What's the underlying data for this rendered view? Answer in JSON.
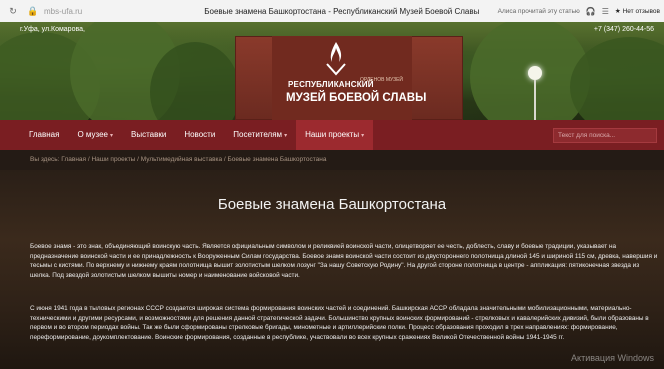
{
  "browser": {
    "url": "mbs-ufa.ru",
    "title": "Боевые знамена Башкортостана - Республиканский Музей Боевой Славы",
    "reader_label": "Алиса прочитай эту статью",
    "favorites_label": "Нет отзывов"
  },
  "header": {
    "address": "г.Уфа, ул.Комарова,",
    "phone": "+7 (347) 260-44-56",
    "brand_line1": "РЕСПУБЛИКАНСКИЙ",
    "brand_line1_small": "ОРДЕНОВ МУЗЕЙ",
    "brand_line2": "МУЗЕЙ БОЕВОЙ СЛАВЫ"
  },
  "menu": {
    "items": [
      {
        "label": "Главная"
      },
      {
        "label": "О музее"
      },
      {
        "label": "Выставки"
      },
      {
        "label": "Новости"
      },
      {
        "label": "Посетителям"
      },
      {
        "label": "Наши проекты"
      }
    ],
    "search_placeholder": "Текст для поиска..."
  },
  "breadcrumb": {
    "text": "Вы здесь: Главная / Наши проекты / Мультимедийная выставка / Боевые знамена Башкортостана"
  },
  "article": {
    "title": "Боевые знамена Башкортостана",
    "paragraph1": "Боевое знамя - это знак, объединяющий воинскую часть. Является официальным символом и реликвией воинской части, олицетворяет ее честь, доблесть, славу и боевые традиции, указывает на предназначение воинской части и ее принадлежность к Вооруженным Силам государства. Боевое знамя воинской части состоит из двустороннего полотнища длиной 145 и шириной 115 см, древка, навершия и тесьмы с кистями. По верхнему и нижнему краям полотнища вышит золотистым шелком лозунг \"За нашу Советскую Родину\". На другой стороне полотнища в центре - аппликация: пятиконечная звезда из шелка. Под звездой золотистым шелком вышиты номер и наименование войсковой части.",
    "paragraph2": "С июня 1941 года в тыловых регионах СССР создается широкая система формирования воинских частей и соединений. Башкирская АССР обладала значительными мобилизационными, материально-техническими и другими ресурсами, и возможностями для решения данной стратегической задачи. Большинство крупных воинских формирований - стрелковых и кавалерийских дивизий, были образованы в первом и во втором периодах войны. Так же были сформированы стрелковые бригады, минометные и артиллерийские полки. Процесс образования проходил в трех направлениях: формирование, переформирование, доукомплектование. Воинские формирования, созданные в республике, участвовали во всех крупных сражениях Великой Отечественной войны 1941-1945 гг."
  },
  "watermark": "Активация Windows",
  "colors": {
    "menu_bg": "#7a1e22",
    "menu_active": "#9c2a2f",
    "content_bg": "#2a1f17"
  }
}
